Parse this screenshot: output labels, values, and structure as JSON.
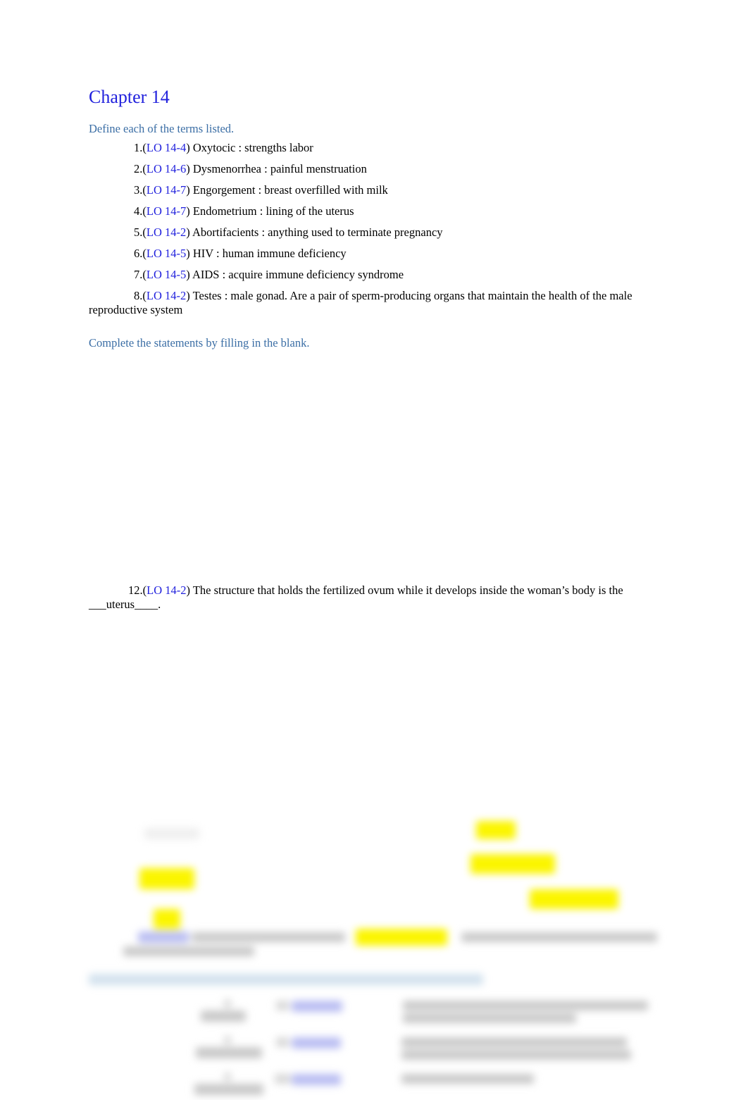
{
  "document": {
    "title": "Chapter 14"
  },
  "sections": {
    "define_heading": "Define each of the terms listed.",
    "complete_heading": "Complete the statements by filling in the blank."
  },
  "definitions": [
    {
      "number": "1.",
      "lo": "LO 14-4",
      "text": ") Oxytocic : strengths labor"
    },
    {
      "number": "2.",
      "lo": "LO 14-6",
      "text": ") Dysmenorrhea : painful menstruation"
    },
    {
      "number": "3.",
      "lo": "LO 14-7",
      "text": ") Engorgement : breast overfilled with milk"
    },
    {
      "number": "4.",
      "lo": "LO 14-7",
      "text": ") Endometrium : lining of the uterus"
    },
    {
      "number": "5.",
      "lo": "LO 14-2",
      "text": ") Abortifacients : anything used to terminate pregnancy"
    },
    {
      "number": "6.",
      "lo": "LO 14-5",
      "text": ") HIV : human immune deficiency"
    },
    {
      "number": "7.",
      "lo": "LO 14-5",
      "text": ") AIDS : acquire immune deficiency syndrome"
    },
    {
      "number": "8.",
      "lo": "LO 14-2",
      "text": ") Testes : male gonad. Are a pair of sperm-producing organs that maintain the health of the male reproductive system"
    }
  ],
  "statement": {
    "number": "12.",
    "lo": "LO 14-2",
    "text": ") The structure that holds the fertilized ovum while it develops inside the woman’s body is the ___uterus____."
  },
  "colors": {
    "title_blue": "#2222dd",
    "heading_blue": "#3b6ea5",
    "lo_link_blue": "#2222dd",
    "highlight_yellow": "#fbf500",
    "body_black": "#000000",
    "page_background": "#ffffff"
  },
  "obscured_region": {
    "note": "Lower portion of page is blurred and illegible",
    "elements": [
      "diagram-blobs-left",
      "diagram-blobs-right",
      "highlighted-paragraph",
      "blurred-section-heading",
      "three-row-table"
    ]
  }
}
